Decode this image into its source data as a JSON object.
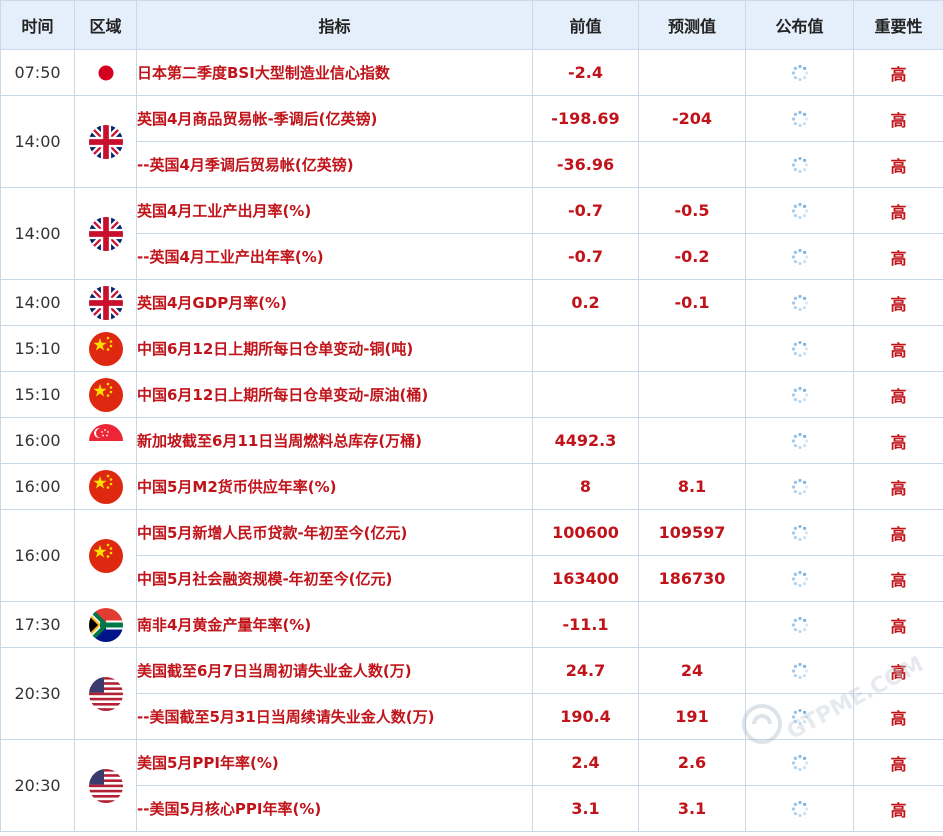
{
  "headers": {
    "time": "时间",
    "region": "区域",
    "indicator": "指标",
    "previous": "前值",
    "forecast": "预测值",
    "actual": "公布值",
    "importance": "重要性"
  },
  "groups": [
    {
      "time": "07:50",
      "flag": "jp",
      "rows": [
        {
          "name": "日本第二季度BSI大型制造业信心指数",
          "previous": "-2.4",
          "forecast": "",
          "importance": "高"
        }
      ]
    },
    {
      "time": "14:00",
      "flag": "gb",
      "rows": [
        {
          "name": "英国4月商品贸易帐-季调后(亿英镑)",
          "previous": "-198.69",
          "forecast": "-204",
          "importance": "高"
        },
        {
          "name": "--英国4月季调后贸易帐(亿英镑)",
          "previous": "-36.96",
          "forecast": "",
          "importance": "高"
        }
      ]
    },
    {
      "time": "14:00",
      "flag": "gb",
      "rows": [
        {
          "name": "英国4月工业产出月率(%)",
          "previous": "-0.7",
          "forecast": "-0.5",
          "importance": "高"
        },
        {
          "name": "--英国4月工业产出年率(%)",
          "previous": "-0.7",
          "forecast": "-0.2",
          "importance": "高"
        }
      ]
    },
    {
      "time": "14:00",
      "flag": "gb",
      "rows": [
        {
          "name": "英国4月GDP月率(%)",
          "previous": "0.2",
          "forecast": "-0.1",
          "importance": "高"
        }
      ]
    },
    {
      "time": "15:10",
      "flag": "cn",
      "rows": [
        {
          "name": "中国6月12日上期所每日仓单变动-铜(吨)",
          "previous": "",
          "forecast": "",
          "importance": "高"
        }
      ]
    },
    {
      "time": "15:10",
      "flag": "cn",
      "rows": [
        {
          "name": "中国6月12日上期所每日仓单变动-原油(桶)",
          "previous": "",
          "forecast": "",
          "importance": "高"
        }
      ]
    },
    {
      "time": "16:00",
      "flag": "sg",
      "rows": [
        {
          "name": "新加坡截至6月11日当周燃料总库存(万桶)",
          "previous": "4492.3",
          "forecast": "",
          "importance": "高"
        }
      ]
    },
    {
      "time": "16:00",
      "flag": "cn",
      "rows": [
        {
          "name": "中国5月M2货币供应年率(%)",
          "previous": "8",
          "forecast": "8.1",
          "importance": "高"
        }
      ]
    },
    {
      "time": "16:00",
      "flag": "cn",
      "rows": [
        {
          "name": "中国5月新增人民币贷款-年初至今(亿元)",
          "previous": "100600",
          "forecast": "109597",
          "importance": "高"
        },
        {
          "name": "中国5月社会融资规模-年初至今(亿元)",
          "previous": "163400",
          "forecast": "186730",
          "importance": "高"
        }
      ]
    },
    {
      "time": "17:30",
      "flag": "za",
      "rows": [
        {
          "name": "南非4月黄金产量年率(%)",
          "previous": "-11.1",
          "forecast": "",
          "importance": "高"
        }
      ]
    },
    {
      "time": "20:30",
      "flag": "us",
      "rows": [
        {
          "name": "美国截至6月7日当周初请失业金人数(万)",
          "previous": "24.7",
          "forecast": "24",
          "importance": "高"
        },
        {
          "name": "--美国截至5月31日当周续请失业金人数(万)",
          "previous": "190.4",
          "forecast": "191",
          "importance": "高"
        }
      ]
    },
    {
      "time": "20:30",
      "flag": "us",
      "rows": [
        {
          "name": "美国5月PPI年率(%)",
          "previous": "2.4",
          "forecast": "2.6",
          "importance": "高"
        },
        {
          "name": "--美国5月核心PPI年率(%)",
          "previous": "3.1",
          "forecast": "3.1",
          "importance": "高"
        }
      ]
    }
  ],
  "colors": {
    "header_bg": "#e4effb",
    "value_red": "#c0141a",
    "border": "#c9d9ea"
  },
  "icons": {
    "actual_pending": "loading-spinner-icon"
  },
  "watermark": {
    "text": "GTPME.COM",
    "logo": "watermark-logo-icon"
  }
}
